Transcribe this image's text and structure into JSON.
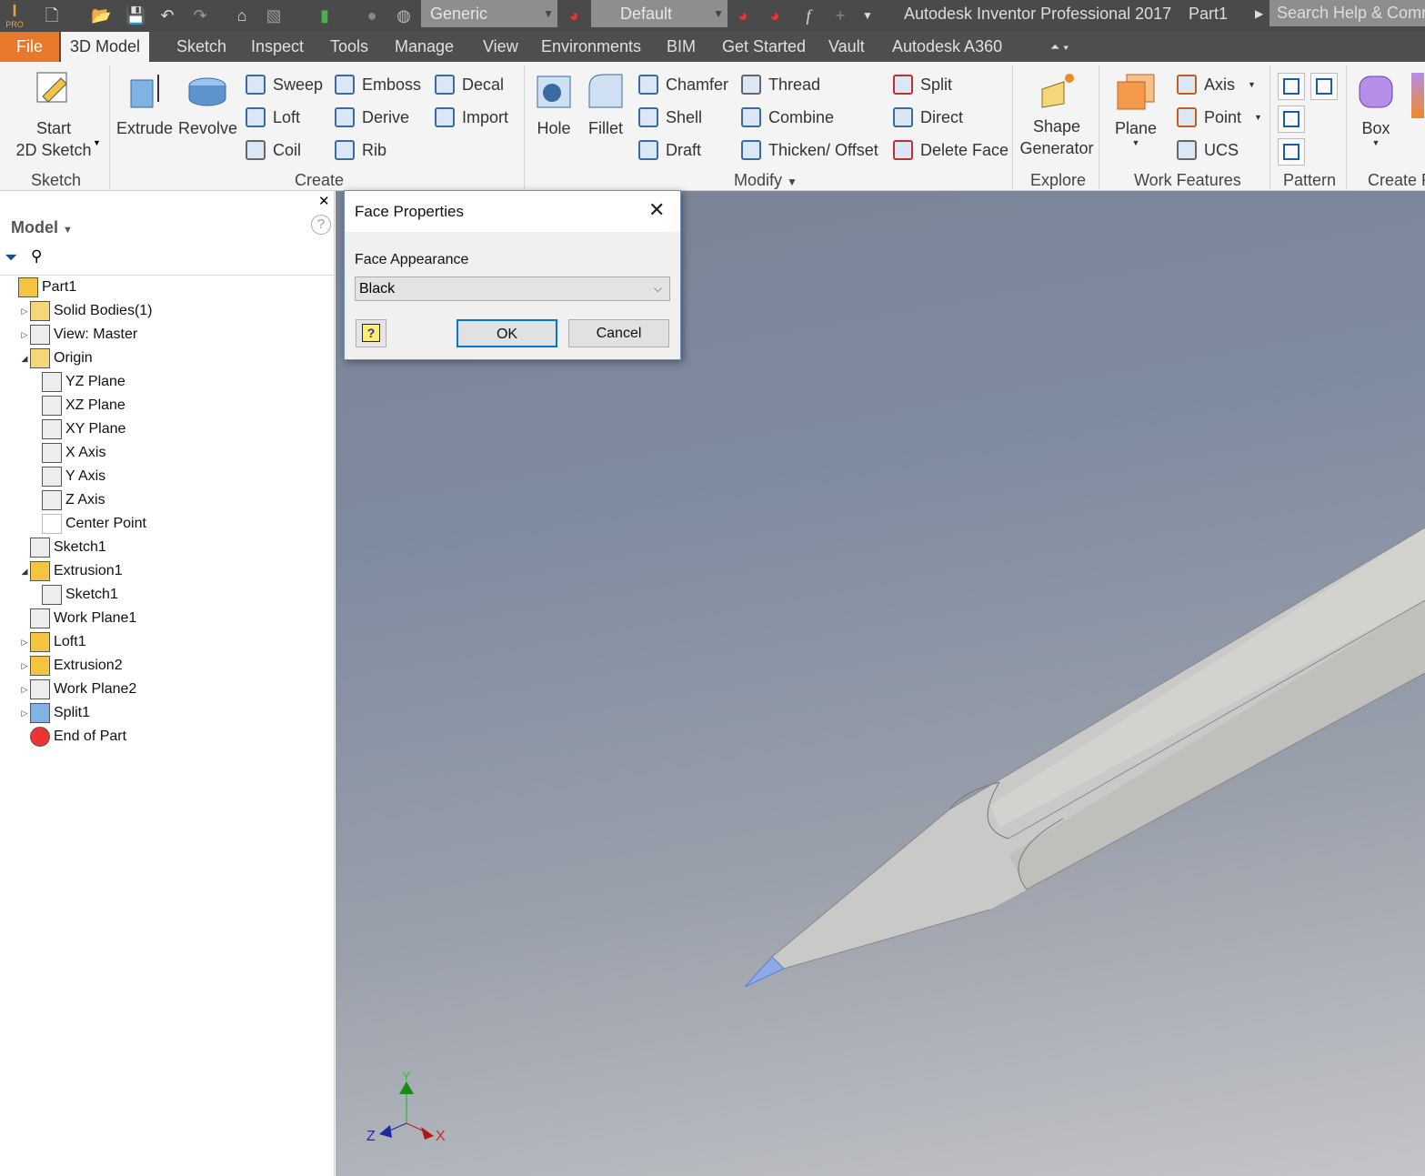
{
  "titlebar": {
    "app_title": "Autodesk Inventor Professional 2017",
    "doc_name": "Part1",
    "search_placeholder": "Search Help & Comm",
    "material_combo": "Generic",
    "appearance_combo": "Default",
    "logo_text": "PRO"
  },
  "tabs": [
    "File",
    "3D Model",
    "Sketch",
    "Inspect",
    "Tools",
    "Manage",
    "View",
    "Environments",
    "BIM",
    "Get Started",
    "Vault",
    "Autodesk A360"
  ],
  "active_tab": "3D Model",
  "ribbon": {
    "sketch": {
      "start_sketch": "Start\n2D Sketch",
      "panel": "Sketch"
    },
    "create": {
      "extrude": "Extrude",
      "revolve": "Revolve",
      "sweep": "Sweep",
      "loft": "Loft",
      "coil": "Coil",
      "emboss": "Emboss",
      "derive": "Derive",
      "rib": "Rib",
      "decal": "Decal",
      "import": "Import",
      "panel": "Create"
    },
    "modify": {
      "hole": "Hole",
      "fillet": "Fillet",
      "chamfer": "Chamfer",
      "shell": "Shell",
      "draft": "Draft",
      "thread": "Thread",
      "combine": "Combine",
      "thicken": "Thicken/ Offset",
      "split": "Split",
      "direct": "Direct",
      "delete_face": "Delete Face",
      "panel": "Modify"
    },
    "explore": {
      "shape_generator": "Shape\nGenerator",
      "panel": "Explore"
    },
    "work_features": {
      "plane": "Plane",
      "axis": "Axis",
      "point": "Point",
      "ucs": "UCS",
      "panel": "Work Features"
    },
    "pattern": {
      "panel": "Pattern"
    },
    "create_freeform": {
      "box": "Box",
      "panel": "Create F"
    }
  },
  "browser": {
    "title": "Model",
    "items": [
      {
        "label": "Part1",
        "level": 0,
        "exp": "",
        "icon": "part-icon"
      },
      {
        "label": "Solid Bodies(1)",
        "level": 1,
        "exp": "collapsed",
        "icon": "folder-icon"
      },
      {
        "label": "View: Master",
        "level": 1,
        "exp": "collapsed",
        "icon": "view-icon"
      },
      {
        "label": "Origin",
        "level": 1,
        "exp": "expanded",
        "icon": "folder-open-icon"
      },
      {
        "label": "YZ Plane",
        "level": 2,
        "exp": "",
        "icon": "plane-icon"
      },
      {
        "label": "XZ Plane",
        "level": 2,
        "exp": "",
        "icon": "plane-icon"
      },
      {
        "label": "XY Plane",
        "level": 2,
        "exp": "",
        "icon": "plane-icon"
      },
      {
        "label": "X Axis",
        "level": 2,
        "exp": "",
        "icon": "axis-icon"
      },
      {
        "label": "Y Axis",
        "level": 2,
        "exp": "",
        "icon": "axis-icon"
      },
      {
        "label": "Z Axis",
        "level": 2,
        "exp": "",
        "icon": "axis-icon"
      },
      {
        "label": "Center Point",
        "level": 2,
        "exp": "",
        "icon": "point-icon"
      },
      {
        "label": "Sketch1",
        "level": 1,
        "exp": "",
        "icon": "sketch-icon"
      },
      {
        "label": "Extrusion1",
        "level": 1,
        "exp": "expanded",
        "icon": "extrusion-icon"
      },
      {
        "label": "Sketch1",
        "level": 2,
        "exp": "",
        "icon": "sketch-icon"
      },
      {
        "label": "Work Plane1",
        "level": 1,
        "exp": "",
        "icon": "plane-icon"
      },
      {
        "label": "Loft1",
        "level": 1,
        "exp": "collapsed",
        "icon": "loft-icon"
      },
      {
        "label": "Extrusion2",
        "level": 1,
        "exp": "collapsed",
        "icon": "extrusion-icon"
      },
      {
        "label": "Work Plane2",
        "level": 1,
        "exp": "collapsed",
        "icon": "plane-icon"
      },
      {
        "label": "Split1",
        "level": 1,
        "exp": "collapsed",
        "icon": "split-icon"
      },
      {
        "label": "End of Part",
        "level": 1,
        "exp": "",
        "icon": "end-of-part-icon"
      }
    ]
  },
  "dialog": {
    "title": "Face Properties",
    "field_label": "Face Appearance",
    "selected_value": "Black",
    "ok": "OK",
    "cancel": "Cancel"
  },
  "triad": {
    "x": "X",
    "y": "Y",
    "z": "Z"
  },
  "colors": {
    "file_tab": "#e8792b",
    "dialog_border": "#6d8fc4",
    "ok_border": "#0078d7",
    "selected_face": "#8fa8e6"
  }
}
